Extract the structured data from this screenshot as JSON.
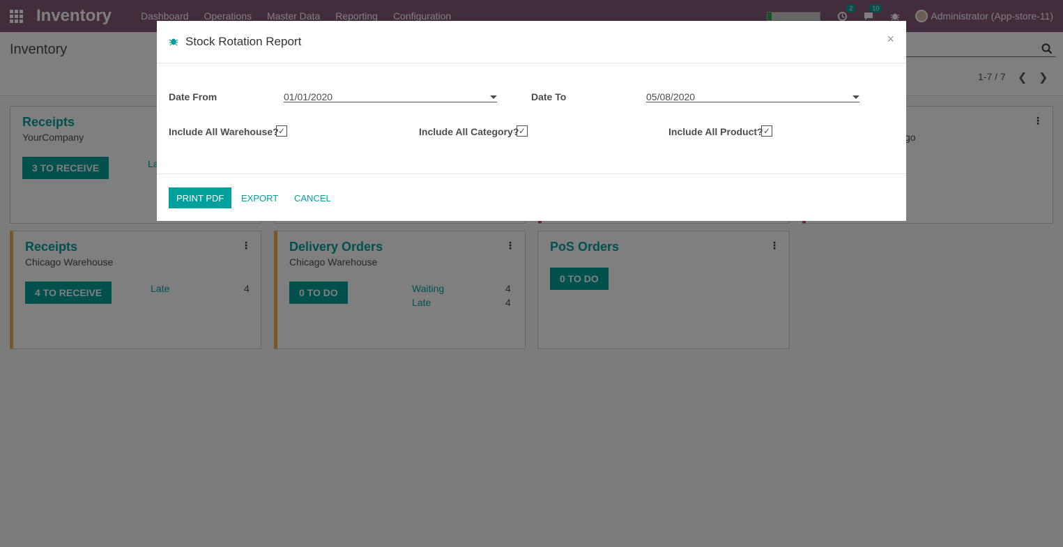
{
  "navbar": {
    "app_name": "Inventory",
    "menu": [
      "Dashboard",
      "Operations",
      "Master Data",
      "Reporting",
      "Configuration"
    ],
    "activity_count": "2",
    "message_count": "10",
    "user": "Administrator (App-store-11)",
    "progress": 0.07
  },
  "control_panel": {
    "breadcrumb": "Inventory",
    "pager": "1-7 / 7"
  },
  "kanban": {
    "card1": {
      "title": "Receipts",
      "subtitle": "YourCompany",
      "button": "3 TO RECEIVE",
      "stat_label": "La"
    },
    "card2_tail": "go",
    "card4": {
      "title": "Receipts",
      "subtitle": "Chicago Warehouse",
      "button": "4 TO RECEIVE",
      "stat_label": "Late",
      "stat_value": "4"
    },
    "card5": {
      "title": "Delivery Orders",
      "subtitle": "Chicago Warehouse",
      "button": "0 TO DO",
      "stat1_label": "Waiting",
      "stat1_value": "4",
      "stat2_label": "Late",
      "stat2_value": "4"
    },
    "card6": {
      "title": "PoS Orders",
      "button": "0 TO DO"
    }
  },
  "modal": {
    "title": "Stock Rotation Report",
    "close": "×",
    "date_from_label": "Date From",
    "date_from_value": "01/01/2020",
    "date_to_label": "Date To",
    "date_to_value": "05/08/2020",
    "warehouse_label": "Include All Warehouse?",
    "category_label": "Include All Category?",
    "product_label": "Include All Product?",
    "checkmark": "✓",
    "print_pdf": "PRINT PDF",
    "export": "EXPORT",
    "cancel": "CANCEL"
  },
  "colors": {
    "brand": "#875a7b",
    "accent": "#00a09d"
  }
}
